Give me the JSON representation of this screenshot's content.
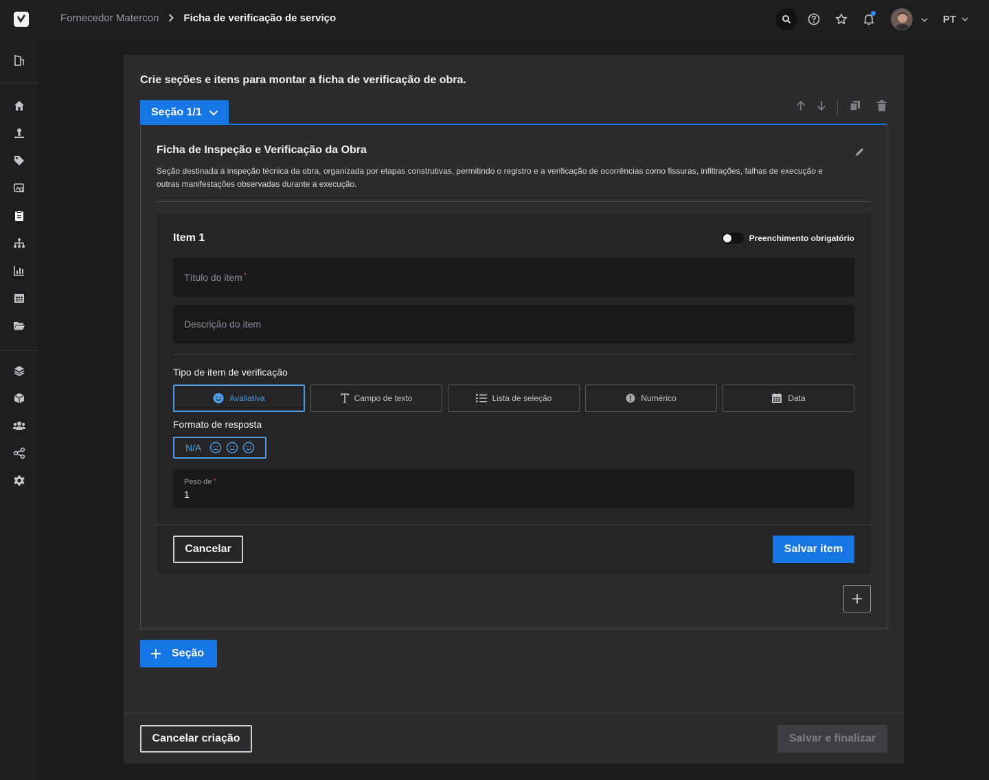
{
  "header": {
    "breadcrumb_parent": "Fornecedor Matercon",
    "breadcrumb_current": "Ficha de verificação de serviço",
    "language": "PT",
    "icons": [
      "search-icon",
      "help-icon",
      "star-icon",
      "bell-icon",
      "avatar",
      "chevron-down-icon"
    ]
  },
  "sidebar": {
    "items": [
      "building-icon",
      "home-icon",
      "worker-icon",
      "tag-icon",
      "image-search-icon",
      "clipboard-icon",
      "hierarchy-icon",
      "chart-icon",
      "calendar-icon",
      "folder-icon",
      "layers-icon",
      "box-icon",
      "users-icon",
      "share-icon",
      "gear-icon"
    ]
  },
  "main": {
    "intro": "Crie seções e itens para montar a ficha de verificação de obra.",
    "section_tab": "Seção 1/1",
    "section": {
      "title": "Ficha de Inspeção e Verificação da Obra",
      "description": "Seção destinada à inspeção técnica da obra, organizada por etapas construtivas, permitindo o registro e a verificação de ocorrências como fissuras, infiltrações, falhas de execução e outras manifestações observadas durante a execução."
    },
    "item": {
      "title": "Item 1",
      "required_toggle_label": "Preenchimento obrigatório",
      "required_toggle_on": false,
      "title_placeholder": "Título do item",
      "title_required_mark": "*",
      "description_placeholder": "Descrição do item",
      "type_label": "Tipo de item de verificação",
      "types": [
        {
          "label": "Avaliativa",
          "icon": "smiley-icon",
          "active": true
        },
        {
          "label": "Campo de texto",
          "icon": "text-icon",
          "active": false
        },
        {
          "label": "Lista de seleção",
          "icon": "list-icon",
          "active": false
        },
        {
          "label": "Numérico",
          "icon": "info-icon",
          "active": false
        },
        {
          "label": "Data",
          "icon": "calendar-icon",
          "active": false
        }
      ],
      "format_label": "Formato de resposta",
      "format_option": "N/A",
      "weight_label": "Peso de",
      "weight_required_mark": "*",
      "weight_value": "1",
      "cancel_label": "Cancelar",
      "save_label": "Salvar item"
    },
    "add_section_label": "Seção",
    "footer": {
      "cancel_label": "Cancelar criação",
      "finish_label": "Salvar e finalizar"
    }
  },
  "colors": {
    "accent": "#1676e5",
    "accent_light": "#4c9ce8",
    "background": "#1c1c1e",
    "panel": "#2c2c2e"
  }
}
